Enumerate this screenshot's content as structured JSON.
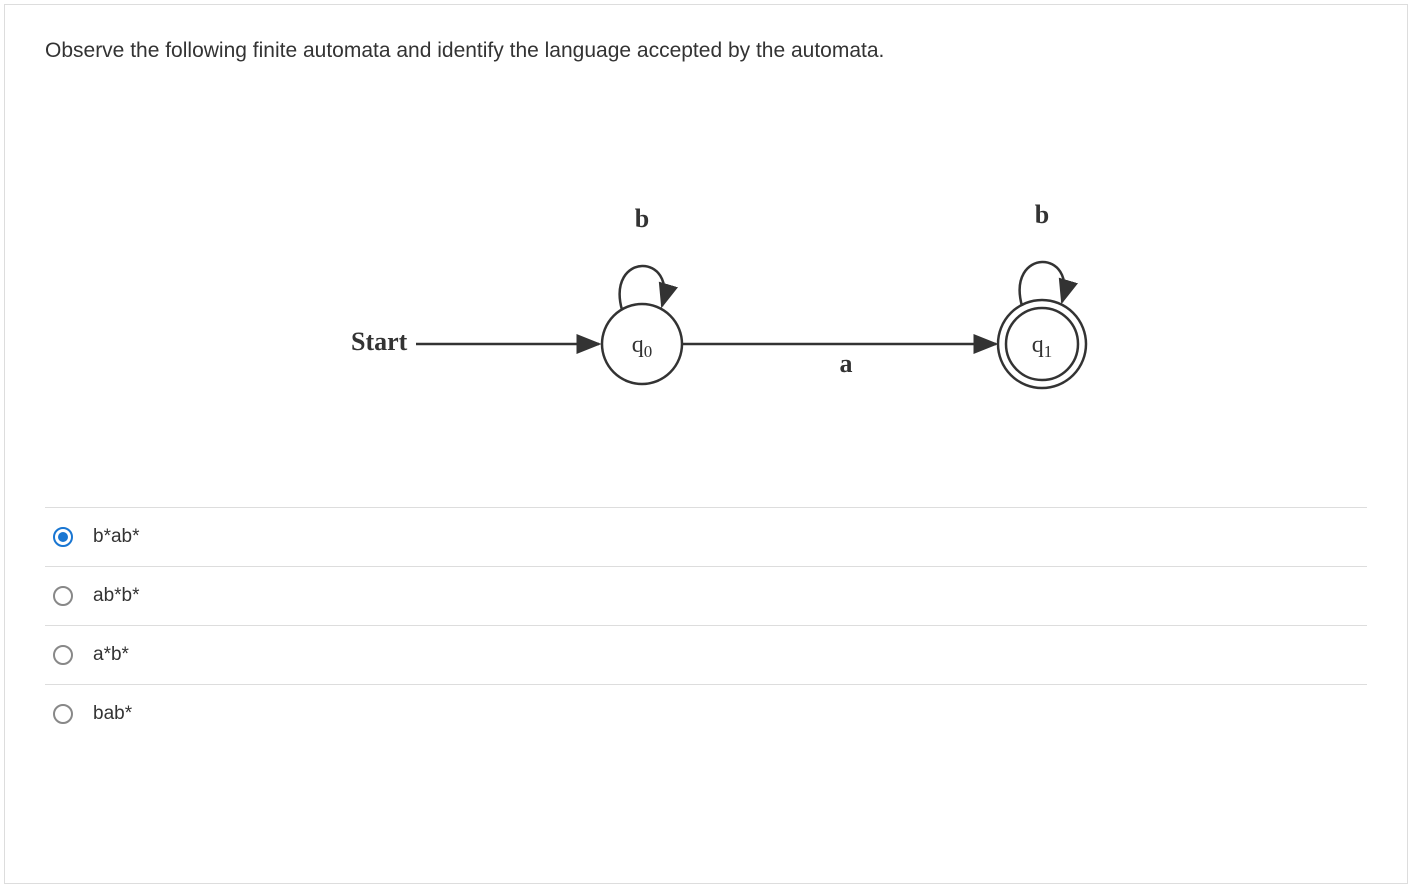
{
  "question": {
    "text": "Observe the following finite automata and identify the language accepted by the automata."
  },
  "diagram": {
    "start_label": "Start",
    "states": [
      {
        "id": "q0",
        "label_base": "q",
        "label_sub": "0",
        "accepting": false,
        "loop_label": "b"
      },
      {
        "id": "q1",
        "label_base": "q",
        "label_sub": "1",
        "accepting": true,
        "loop_label": "b"
      }
    ],
    "transitions": [
      {
        "from": "start",
        "to": "q0",
        "label": ""
      },
      {
        "from": "q0",
        "to": "q1",
        "label": "a"
      }
    ]
  },
  "options": [
    {
      "id": "opt1",
      "label": "b*ab*",
      "selected": true
    },
    {
      "id": "opt2",
      "label": "ab*b*",
      "selected": false
    },
    {
      "id": "opt3",
      "label": "a*b*",
      "selected": false
    },
    {
      "id": "opt4",
      "label": "bab*",
      "selected": false
    }
  ],
  "chart_data": {
    "type": "finite_automaton",
    "alphabet": [
      "a",
      "b"
    ],
    "start_state": "q0",
    "accepting_states": [
      "q1"
    ],
    "states": [
      "q0",
      "q1"
    ],
    "transitions": [
      {
        "from": "q0",
        "input": "b",
        "to": "q0"
      },
      {
        "from": "q0",
        "input": "a",
        "to": "q1"
      },
      {
        "from": "q1",
        "input": "b",
        "to": "q1"
      }
    ],
    "accepted_language_regex": "b*ab*"
  }
}
